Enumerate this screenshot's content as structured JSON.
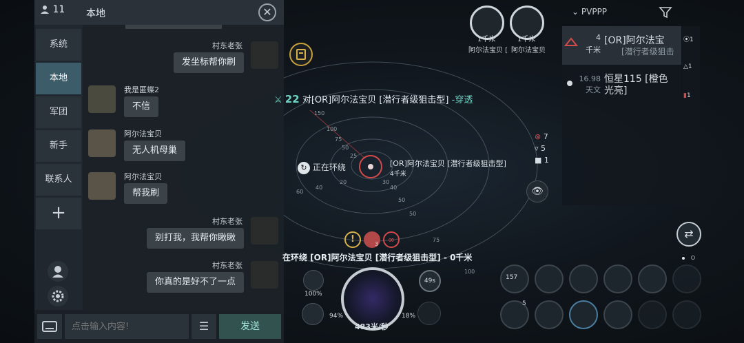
{
  "chat": {
    "member_count": "11",
    "channel_title": "本地",
    "tabs": [
      "系统",
      "本地",
      "军团",
      "新手",
      "联系人"
    ],
    "active_tab": "本地",
    "messages": [
      {
        "sender": "村东老张",
        "text": "发坐标帮你刷",
        "side": "right"
      },
      {
        "sender": "我是匿蝶2",
        "text": "不信",
        "side": "left"
      },
      {
        "sender": "阿尔法宝贝",
        "text": "无人机母巢",
        "side": "left"
      },
      {
        "sender": "阿尔法宝贝",
        "text": "帮我刷",
        "side": "left"
      },
      {
        "sender": "村东老张",
        "text": "别打我，我帮你瞅瞅",
        "side": "right"
      },
      {
        "sender": "村东老张",
        "text": "你真的是好不了一点",
        "side": "right"
      }
    ],
    "input_placeholder": "点击输入内容!",
    "send_label": "发送"
  },
  "hud": {
    "target_marker_1": "1千米",
    "target_marker_2": "1千米",
    "target_label_1": "阿尔法宝贝 [五型 渗透",
    "target_label_2": "阿尔法宝贝 [潜行",
    "combat_count": "22",
    "combat_text": "对[OR]阿尔法宝贝 [潜行者级狙击型]",
    "combat_effect": "-穿透",
    "orbit_status": "正在环绕",
    "orbit_target": "[OR]阿尔法宝贝 [潜行者级狙击型]",
    "orbit_distance": "4千米",
    "bottom_status": "在环绕 [OR]阿尔法宝贝 [潜行者级狙击型] - 0千米",
    "radar_ticks": [
      "150",
      "100",
      "75",
      "50",
      "25",
      "20",
      "40",
      "60",
      "40",
      "30",
      "50",
      "50",
      "75",
      "100"
    ],
    "stats": [
      {
        "icon": "hostile-icon",
        "value": "7"
      },
      {
        "icon": "neutral-icon",
        "value": "5"
      },
      {
        "icon": "square-icon",
        "value": "1"
      }
    ],
    "speed": "483米/秒",
    "shield_pct": "94%",
    "armor_pct": "18%",
    "cap_pct": "100%",
    "timer": "49s",
    "buff_count": "3"
  },
  "overview": {
    "filter_name": "PVPPP",
    "rows": [
      {
        "distance": "4",
        "unit": "千米",
        "name": "[OR]阿尔法宝",
        "subtitle": "[潜行者级狙击"
      },
      {
        "distance": "16.98",
        "unit": "天文",
        "name": "恒星115 [橙色",
        "subtitle": "光亮]"
      }
    ],
    "side_counts": [
      "1",
      "1",
      "1"
    ]
  },
  "modules": {
    "top_row": [
      {
        "count": "157"
      },
      {
        "count": ""
      },
      {
        "count": ""
      },
      {
        "count": ""
      },
      {
        "count": ""
      }
    ],
    "drone_count": "5"
  },
  "colors": {
    "accent": "#6fd3c4",
    "hostile": "#d64a4a",
    "panel": "#1c2228"
  }
}
